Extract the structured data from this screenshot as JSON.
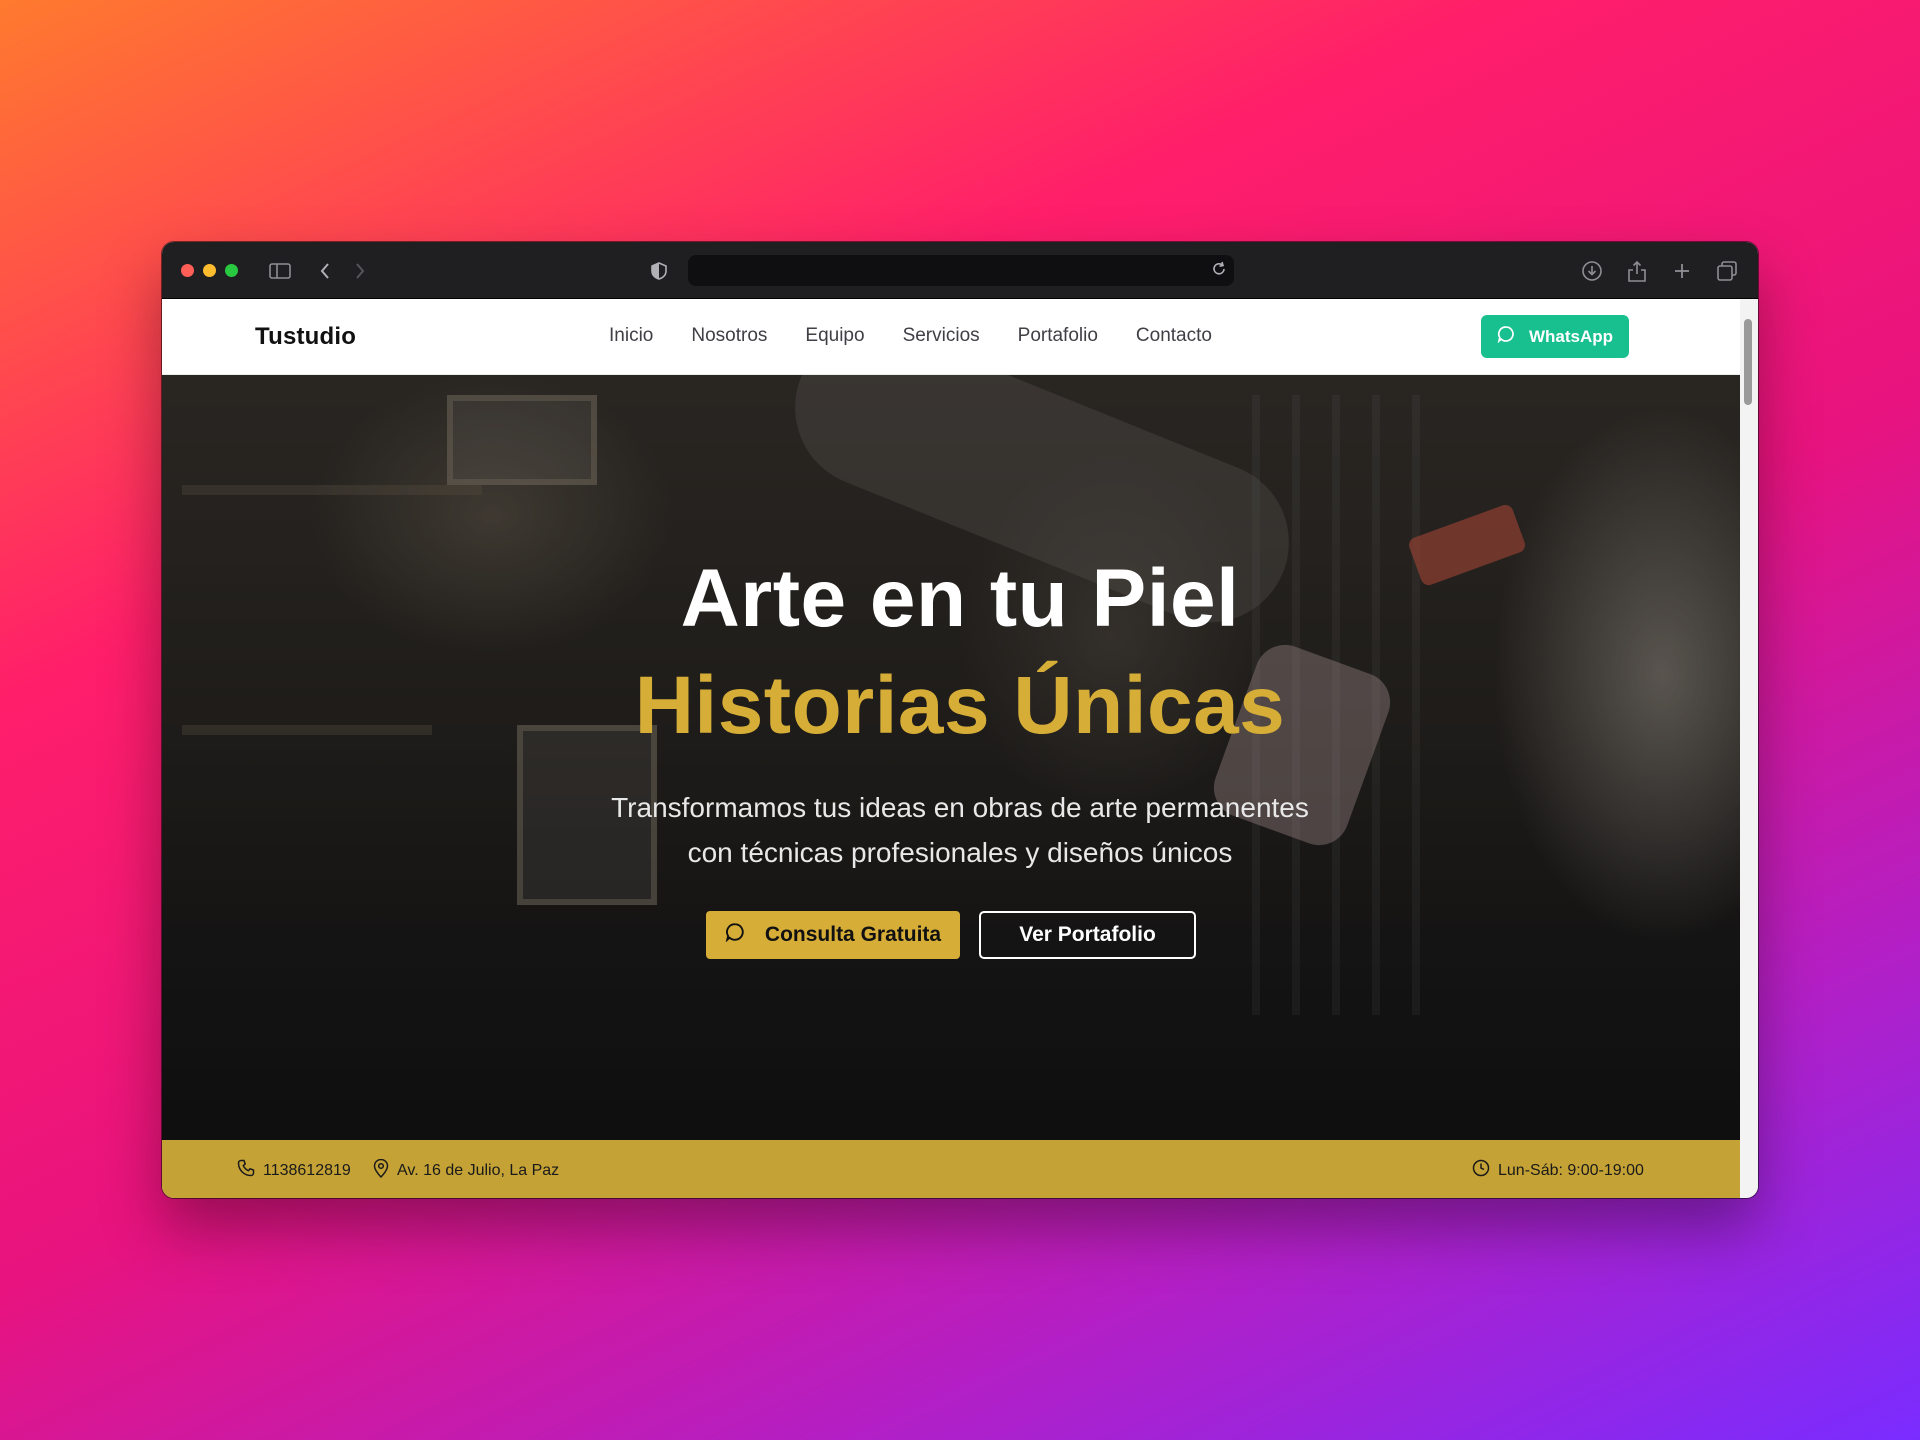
{
  "browser": {
    "address": "",
    "icons": {
      "sidebar": "sidebar-toggle-icon",
      "back": "chevron-left-icon",
      "forward": "chevron-right-icon",
      "privacy": "shield-icon",
      "reload": "reload-icon",
      "download": "download-icon",
      "share": "share-icon",
      "new_tab": "plus-icon",
      "tabs": "tabs-overview-icon"
    }
  },
  "header": {
    "logo": "Tustudio",
    "nav": [
      "Inicio",
      "Nosotros",
      "Equipo",
      "Servicios",
      "Portafolio",
      "Contacto"
    ],
    "whatsapp_label": "WhatsApp"
  },
  "hero": {
    "title_line1": "Arte en tu Piel",
    "title_line2": "Historias Únicas",
    "subtitle_line1": "Transformamos tus ideas en obras de arte permanentes",
    "subtitle_line2": "con técnicas profesionales y diseños únicos",
    "cta_primary": "Consulta Gratuita",
    "cta_secondary": "Ver Portafolio"
  },
  "infobar": {
    "phone": "1138612819",
    "address": "Av. 16 de Julio, La Paz",
    "hours": "Lun-Sáb: 9:00-19:00"
  },
  "colors": {
    "accent_gold": "#d6ad37",
    "infobar_gold": "#c4a235",
    "whatsapp_green": "#18c08f",
    "titlebar": "#1f1f22"
  }
}
